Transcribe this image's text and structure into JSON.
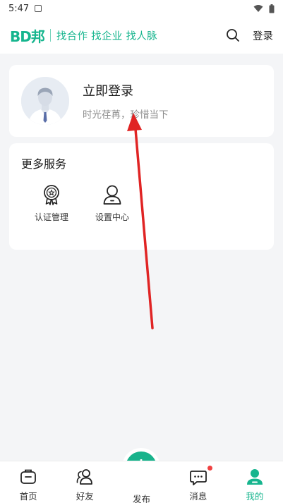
{
  "status_bar": {
    "time": "5:47"
  },
  "header": {
    "logo": "BD邦",
    "slogan": "找合作 找企业 找人脉",
    "login_label": "登录"
  },
  "profile": {
    "title": "立即登录",
    "subtitle": "时光荏苒，珍惜当下"
  },
  "services": {
    "title": "更多服务",
    "items": [
      {
        "label": "认证管理",
        "icon": "certificate-icon"
      },
      {
        "label": "设置中心",
        "icon": "user-settings-icon"
      }
    ]
  },
  "tabbar": {
    "items": [
      {
        "label": "首页",
        "icon": "home-icon"
      },
      {
        "label": "好友",
        "icon": "friends-icon"
      },
      {
        "label": "发布",
        "icon": "plus-icon"
      },
      {
        "label": "消息",
        "icon": "message-icon"
      },
      {
        "label": "我的",
        "icon": "profile-icon"
      }
    ],
    "active_index": 4,
    "message_badge": true
  },
  "colors": {
    "brand": "#16b58e",
    "badge": "#f04141",
    "annotation_arrow": "#e02424"
  }
}
